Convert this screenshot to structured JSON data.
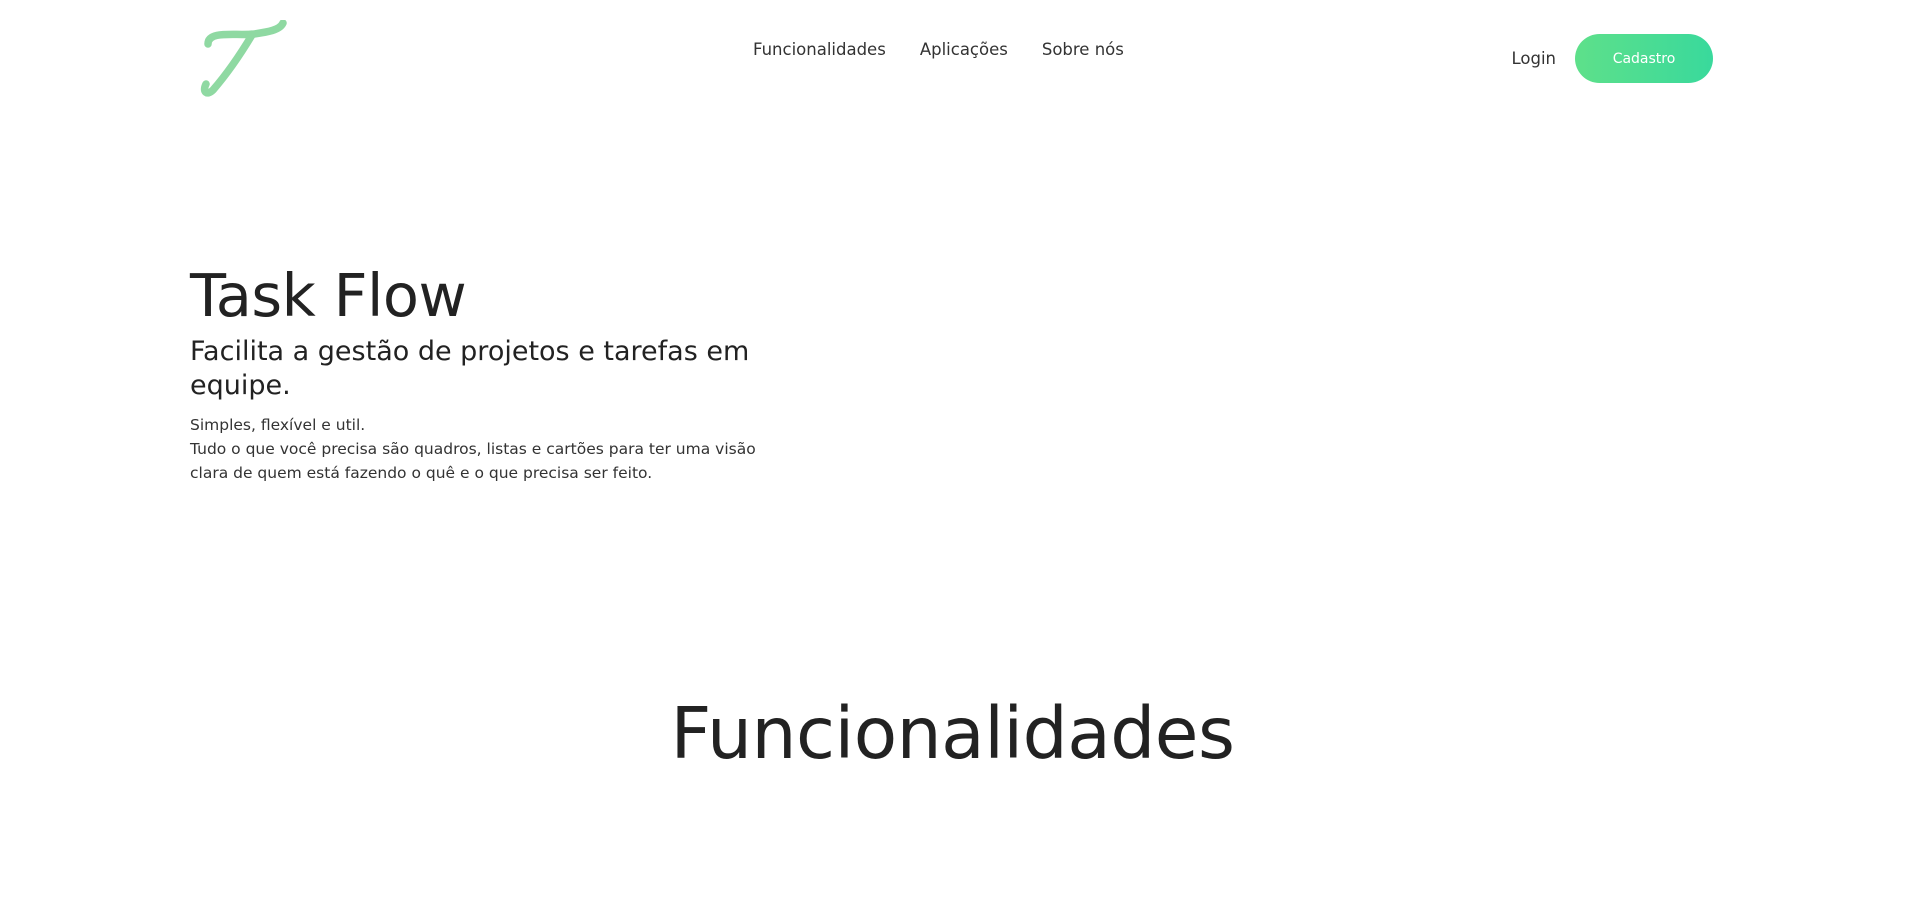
{
  "brand": {
    "logo_icon": "task-flow-t-logo",
    "logo_color": "#8fd9a2"
  },
  "nav": {
    "items": [
      {
        "label": "Funcionalidades"
      },
      {
        "label": "Aplicações"
      },
      {
        "label": "Sobre nós"
      }
    ]
  },
  "auth": {
    "login_label": "Login",
    "signup_label": "Cadastro",
    "signup_color": "#44dc93"
  },
  "hero": {
    "title": "Task Flow",
    "subtitle": "Facilita a gestão de projetos e tarefas em equipe.",
    "tagline": "Simples, flexível e util.",
    "description": "Tudo o que você precisa são quadros, listas e cartões para ter uma visão clara de quem está fazendo o quê e o que precisa ser feito."
  },
  "features": {
    "title": "Funcionalidades"
  }
}
